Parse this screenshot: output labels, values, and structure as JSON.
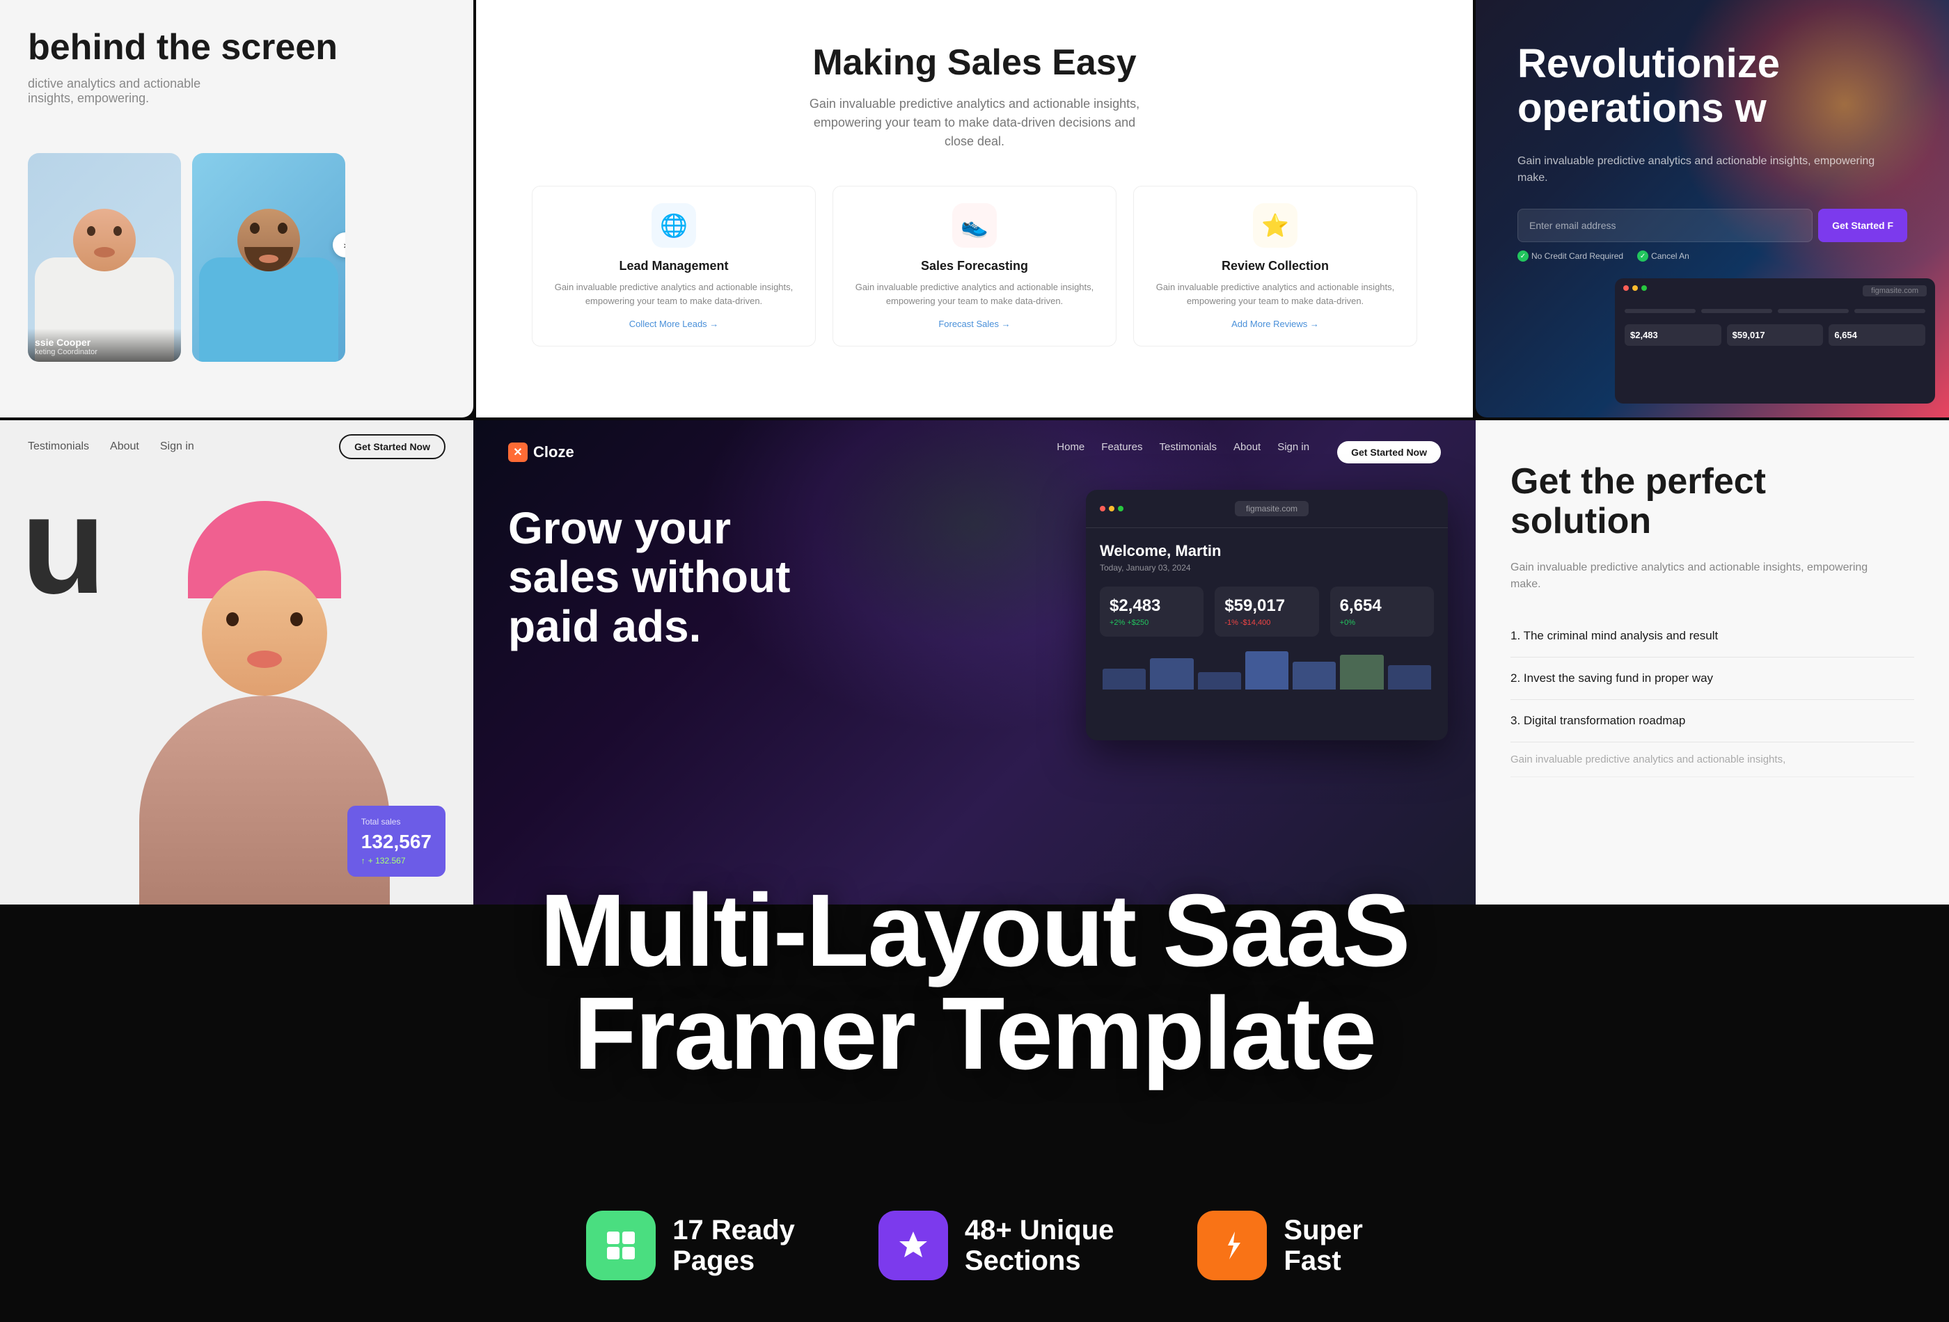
{
  "page": {
    "title": "Multi-Layout SaaS Framer Template"
  },
  "top_panels": {
    "left": {
      "title": "behind the screen",
      "subtitle": "dictive analytics and actionable insights, empowering.",
      "person1": {
        "name": "ssie Cooper",
        "role": "keting Coordinator"
      },
      "person2": {
        "name": "",
        "role": ""
      }
    },
    "center": {
      "title": "Making Sales Easy",
      "subtitle": "Gain invaluable predictive analytics and actionable insights, empowering your team to make data-driven decisions and close deal.",
      "features": [
        {
          "icon": "🌐",
          "name": "Lead Management",
          "desc": "Gain invaluable predictive analytics and actionable insights, empowering your team to make data-driven.",
          "link": "Collect More Leads →"
        },
        {
          "icon": "👟",
          "name": "Sales Forecasting",
          "desc": "Gain invaluable predictive analytics and actionable insights, empowering your team to make data-driven.",
          "link": "Forecast Sales →"
        },
        {
          "icon": "⭐",
          "name": "Review Collection",
          "desc": "Gain invaluable predictive analytics and actionable insights, empowering your team to make data-driven.",
          "link": "Add More Reviews →"
        }
      ]
    },
    "right": {
      "title": "Revolutionize operations w",
      "subtitle": "Gain invaluable predictive analytics and actionable insights, empowering make.",
      "email_placeholder": "Enter email address",
      "btn_label": "Get Started F",
      "trust1": "No Credit Card Required",
      "trust2": "Cancel An"
    }
  },
  "bottom_panels": {
    "left": {
      "nav_links": [
        "Testimonials",
        "About",
        "Sign in"
      ],
      "cta": "Get Started Now",
      "sales_label": "Total sales",
      "sales_value": "132,567",
      "sales_change": "+ 132.567"
    },
    "center": {
      "logo": "Cloze",
      "logo_symbol": "✕",
      "nav_links": [
        "Home",
        "Features",
        "Testimonials",
        "About"
      ],
      "sign_in": "Sign in",
      "get_started": "Get Started Now",
      "hero_headline": "Grow your sales without paid ads.",
      "dashboard": {
        "greeting": "Welcome, Martin",
        "date": "Today, January 03, 2024",
        "url": "figmasite.com",
        "stats": [
          {
            "value": "$2,483",
            "change": "+2%",
            "delta": "+$250",
            "positive": true
          },
          {
            "value": "$59,017",
            "change": "-1%",
            "delta": "-$14,400",
            "positive": false
          },
          {
            "value": "6,654",
            "change": "+0%",
            "delta": "",
            "positive": true
          }
        ]
      }
    },
    "right": {
      "title": "Get the perfect solution",
      "subtitle": "Gain invaluable predictive analytics and actionable insights, empowering make.",
      "items": [
        "1. The criminal mind analysis and result",
        "2. Invest the saving fund in proper way",
        "3. Digital transformation roadmap"
      ],
      "faded_text": "Gain invaluable predictive analytics and actionable insights,"
    }
  },
  "main_title": {
    "line1": "Multi-Layout SaaS",
    "line2": "Framer Template"
  },
  "features_bar": [
    {
      "icon": "⊞",
      "icon_bg": "green",
      "label": "17 Ready",
      "sublabel": "Pages"
    },
    {
      "icon": "✦",
      "icon_bg": "purple",
      "label": "48+ Unique",
      "sublabel": "Sections"
    },
    {
      "icon": "⚡",
      "icon_bg": "orange",
      "label": "Super",
      "sublabel": "Fast"
    }
  ]
}
